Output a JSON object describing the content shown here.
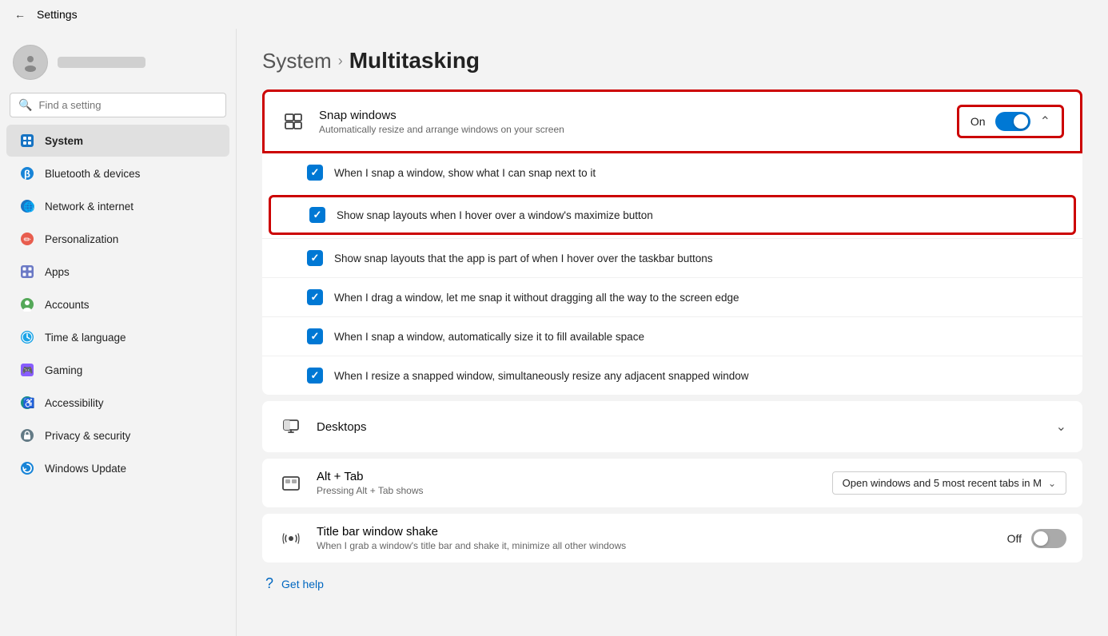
{
  "titlebar": {
    "back_label": "←",
    "title": "Settings"
  },
  "sidebar": {
    "search_placeholder": "Find a setting",
    "items": [
      {
        "id": "system",
        "label": "System",
        "icon": "⊞",
        "icon_class": "icon-system",
        "active": true
      },
      {
        "id": "bluetooth",
        "label": "Bluetooth & devices",
        "icon": "⬡",
        "icon_class": "icon-bluetooth",
        "active": false
      },
      {
        "id": "network",
        "label": "Network & internet",
        "icon": "🌐",
        "icon_class": "icon-network",
        "active": false
      },
      {
        "id": "personalization",
        "label": "Personalization",
        "icon": "✏",
        "icon_class": "icon-personalization",
        "active": false
      },
      {
        "id": "apps",
        "label": "Apps",
        "icon": "⊞",
        "icon_class": "icon-apps",
        "active": false
      },
      {
        "id": "accounts",
        "label": "Accounts",
        "icon": "◉",
        "icon_class": "icon-accounts",
        "active": false
      },
      {
        "id": "time",
        "label": "Time & language",
        "icon": "◷",
        "icon_class": "icon-time",
        "active": false
      },
      {
        "id": "gaming",
        "label": "Gaming",
        "icon": "🎮",
        "icon_class": "icon-gaming",
        "active": false
      },
      {
        "id": "accessibility",
        "label": "Accessibility",
        "icon": "♿",
        "icon_class": "icon-accessibility",
        "active": false
      },
      {
        "id": "privacy",
        "label": "Privacy & security",
        "icon": "🛡",
        "icon_class": "icon-privacy",
        "active": false
      },
      {
        "id": "update",
        "label": "Windows Update",
        "icon": "↻",
        "icon_class": "icon-update",
        "active": false
      }
    ]
  },
  "breadcrumb": {
    "system": "System",
    "separator": "›",
    "page": "Multitasking"
  },
  "snap_windows": {
    "title": "Snap windows",
    "subtitle": "Automatically resize and arrange windows on your screen",
    "toggle_state": "On",
    "toggle_on": true,
    "checkboxes": [
      {
        "id": "cb1",
        "label": "When I snap a window, show what I can snap next to it",
        "checked": true,
        "highlighted": false
      },
      {
        "id": "cb2",
        "label": "Show snap layouts when I hover over a window's maximize button",
        "checked": true,
        "highlighted": true
      },
      {
        "id": "cb3",
        "label": "Show snap layouts that the app is part of when I hover over the taskbar buttons",
        "checked": true,
        "highlighted": false
      },
      {
        "id": "cb4",
        "label": "When I drag a window, let me snap it without dragging all the way to the screen edge",
        "checked": true,
        "highlighted": false
      },
      {
        "id": "cb5",
        "label": "When I snap a window, automatically size it to fill available space",
        "checked": true,
        "highlighted": false
      },
      {
        "id": "cb6",
        "label": "When I resize a snapped window, simultaneously resize any adjacent snapped window",
        "checked": true,
        "highlighted": false
      }
    ]
  },
  "desktops": {
    "title": "Desktops"
  },
  "alt_tab": {
    "title": "Alt + Tab",
    "subtitle": "Pressing Alt + Tab shows",
    "dropdown_value": "Open windows and 5 most recent tabs in M"
  },
  "titlebar_shake": {
    "title": "Title bar window shake",
    "subtitle": "When I grab a window's title bar and shake it, minimize all other windows",
    "toggle_state": "Off",
    "toggle_on": false
  },
  "get_help": {
    "label": "Get help"
  }
}
